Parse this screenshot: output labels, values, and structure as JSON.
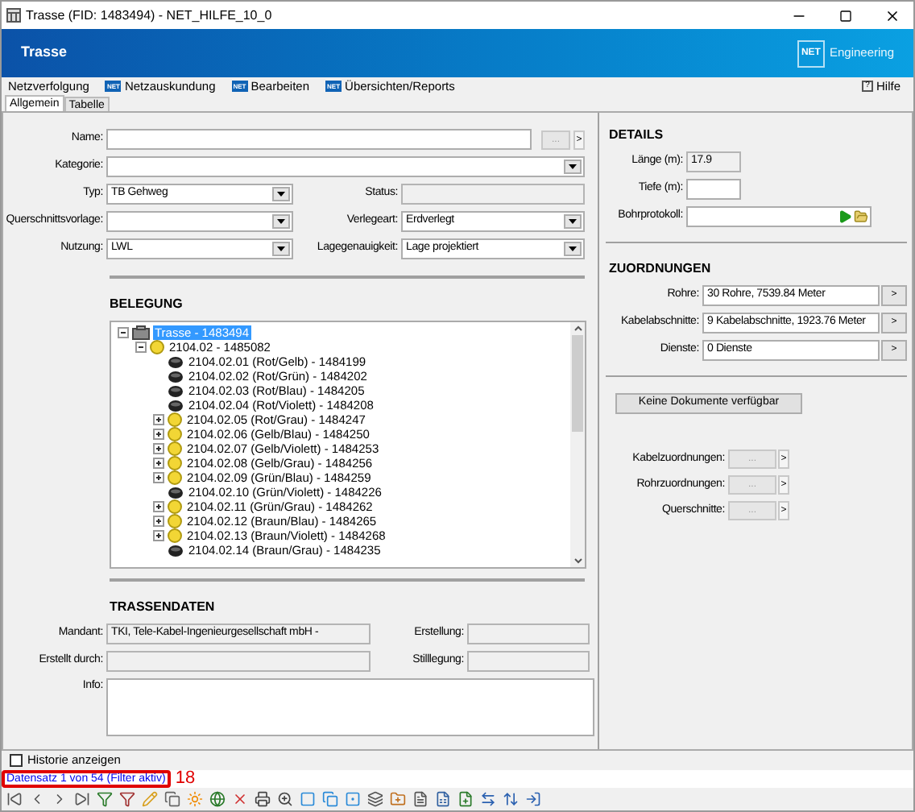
{
  "window": {
    "title": "Trasse (FID: 1483494) - NET_HILFE_10_0"
  },
  "header": {
    "title": "Trasse",
    "logo": "NET",
    "brand": "Engineering"
  },
  "menu": [
    {
      "label": "Netzverfolgung"
    },
    {
      "label": "Netzauskundung",
      "icon": "NET"
    },
    {
      "label": "Bearbeiten",
      "icon": "NET"
    },
    {
      "label": "Übersichten/Reports",
      "icon": "NET"
    }
  ],
  "help": {
    "icon": "?",
    "label": "Hilfe"
  },
  "tabs": [
    {
      "label": "Allgemein",
      "selected": true
    },
    {
      "label": "Tabelle",
      "selected": false
    }
  ],
  "form": {
    "name": {
      "label": "Name:",
      "buttons": [
        "...",
        ">"
      ]
    },
    "kategorie": {
      "label": "Kategorie:",
      "kind": "select"
    },
    "grid": [
      [
        {
          "label": "Typ:",
          "kind": "select",
          "value": "TB Gehweg"
        },
        {
          "label": "Status:",
          "kind": "readonly"
        }
      ],
      [
        {
          "label": "Querschnittsvorlage:",
          "kind": "select"
        },
        {
          "label": "Verlegeart:",
          "kind": "select",
          "value": "Erdverlegt"
        }
      ],
      [
        {
          "label": "Nutzung:",
          "kind": "select",
          "value": "LWL"
        },
        {
          "label": "Lagegenauigkeit:",
          "kind": "select",
          "value": "Lage projektiert"
        }
      ]
    ]
  },
  "belegung": {
    "title": "BELEGUNG",
    "tree": [
      {
        "label": "Trasse - 1483494",
        "kind": "trasse",
        "selected": true,
        "expanded": true,
        "children": [
          {
            "label": "2104.02 - 1485082",
            "kind": "bundle",
            "selected": false,
            "expanded": true,
            "children": [
              {
                "label": "2104.02.01 (Rot/Gelb) - 1484199",
                "kind": "fiber",
                "selected": false
              },
              {
                "label": "2104.02.02 (Rot/Grün) - 1484202",
                "kind": "fiber",
                "selected": false
              },
              {
                "label": "2104.02.03 (Rot/Blau) - 1484205",
                "kind": "fiber",
                "selected": false
              },
              {
                "label": "2104.02.04 (Rot/Violett) - 1484208",
                "kind": "fiber",
                "selected": false
              },
              {
                "label": "2104.02.05 (Rot/Grau) - 1484247",
                "kind": "bundle",
                "selected": false,
                "expanded": false
              },
              {
                "label": "2104.02.06 (Gelb/Blau) - 1484250",
                "kind": "bundle",
                "selected": false,
                "expanded": false
              },
              {
                "label": "2104.02.07 (Gelb/Violett) - 1484253",
                "kind": "bundle",
                "selected": false,
                "expanded": false
              },
              {
                "label": "2104.02.08 (Gelb/Grau) - 1484256",
                "kind": "bundle",
                "selected": false,
                "expanded": false
              },
              {
                "label": "2104.02.09 (Grün/Blau) - 1484259",
                "kind": "bundle",
                "selected": false,
                "expanded": false
              },
              {
                "label": "2104.02.10 (Grün/Violett) - 1484226",
                "kind": "fiber",
                "selected": false
              },
              {
                "label": "2104.02.11 (Grün/Grau) - 1484262",
                "kind": "bundle",
                "selected": false,
                "expanded": false
              },
              {
                "label": "2104.02.12 (Braun/Blau) - 1484265",
                "kind": "bundle",
                "selected": false,
                "expanded": false
              },
              {
                "label": "2104.02.13 (Braun/Violett) - 1484268",
                "kind": "bundle",
                "selected": false,
                "expanded": false
              },
              {
                "label": "2104.02.14 (Braun/Grau) - 1484235",
                "kind": "fiber",
                "selected": false
              }
            ]
          }
        ]
      }
    ]
  },
  "trassendaten": {
    "title": "TRASSENDATEN",
    "rows": [
      [
        {
          "label": "Mandant:",
          "kind": "readonly",
          "value": "TKI, Tele-Kabel-Ingenieurgesellschaft mbH -"
        },
        {
          "label": "Erstellung:",
          "kind": "readonly"
        }
      ],
      [
        {
          "label": "Erstellt durch:",
          "kind": "readonly"
        },
        {
          "label": "Stilllegung:",
          "kind": "readonly"
        }
      ]
    ],
    "info": {
      "label": "Info:"
    }
  },
  "details": {
    "title": "DETAILS",
    "fields": [
      {
        "label": "Länge (m):",
        "kind": "readonly",
        "value": "17.9"
      },
      {
        "label": "Tiefe (m):",
        "kind": "text"
      },
      {
        "label": "Bohrprotokoll:",
        "kind": "file"
      }
    ]
  },
  "zuordnungen": {
    "title": "ZUORDNUNGEN",
    "fields": [
      {
        "label": "Rohre:",
        "value": "30 Rohre, 7539.84 Meter",
        "button": ">"
      },
      {
        "label": "Kabelabschnitte:",
        "value": "9 Kabelabschnitte, 1923.76 Meter",
        "button": ">"
      },
      {
        "label": "Dienste:",
        "value": "0 Dienste",
        "button": ">"
      }
    ]
  },
  "documents_button": "Keine Dokumente verfügbar",
  "links": [
    {
      "label": "Kabelzuordnungen:",
      "button": "...",
      "arrow": ">"
    },
    {
      "label": "Rohrzuordnungen:",
      "button": "...",
      "arrow": ">"
    },
    {
      "label": "Querschnitte:",
      "button": "...",
      "arrow": ">"
    }
  ],
  "history": {
    "label": "Historie anzeigen",
    "checked": false
  },
  "status": {
    "text": "Datensatz 1 von 54 (Filter aktiv)",
    "annotation": "18"
  }
}
